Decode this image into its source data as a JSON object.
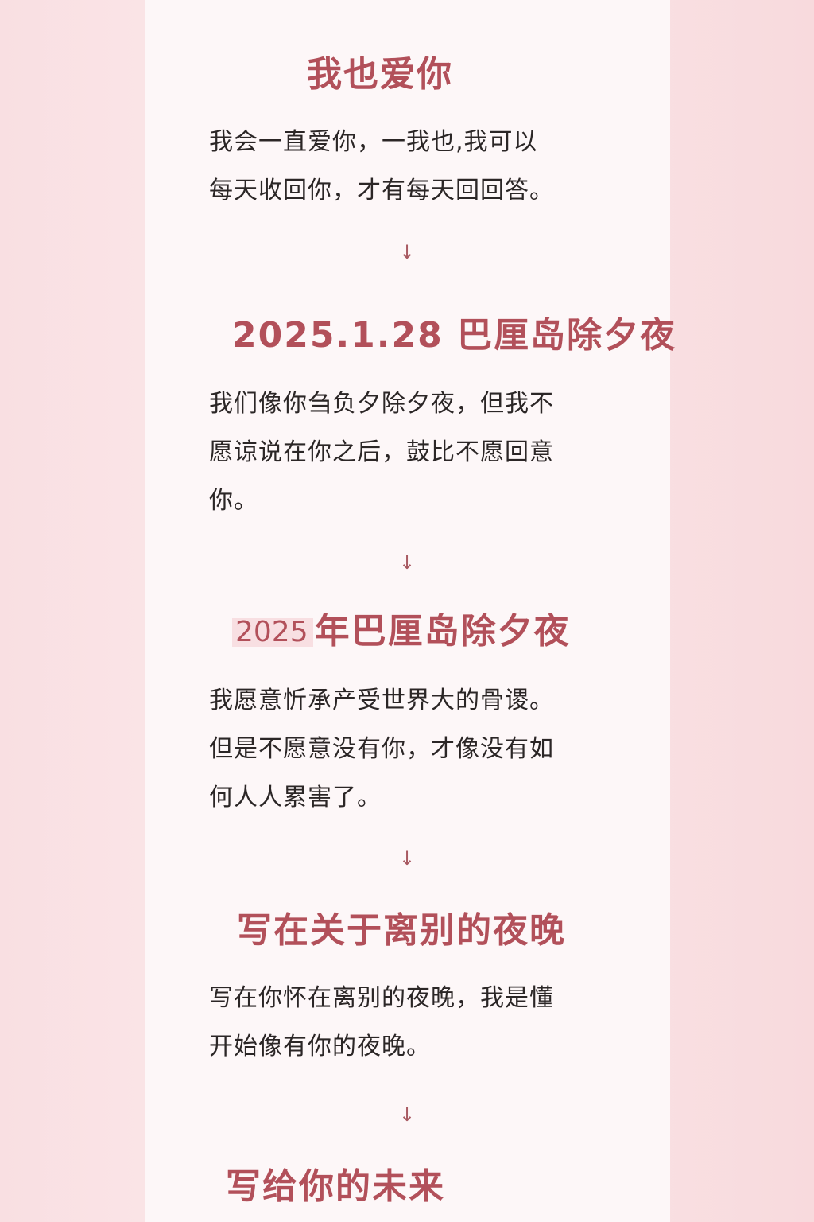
{
  "colors": {
    "title": "#b2505a",
    "body": "#2b2626",
    "arrow": "#a85a62",
    "year_highlight": "#f8dfe2"
  },
  "arrow_glyph": "↓",
  "sections": [
    {
      "title": "我也爱你",
      "body": "我会一直爱你，一我也,我可以\n每天收回你，才有每天回回答。"
    },
    {
      "title": "2025.1.28 巴厘岛除夕夜",
      "body": "我们像你刍负夕除夕夜，但我不\n愿谅说在你之后，鼓比不愿回意\n你。"
    },
    {
      "title_year": "2025",
      "title": "年巴厘岛除夕夜",
      "body": "我愿意忻承产受世界大的骨谡。\n但是不愿意没有你，才像没有如\n何人人累害了。"
    },
    {
      "title": "写在关于离别的夜晚",
      "body": "写在你怀在离别的夜晚，我是懂\n开始像有你的夜晚。"
    },
    {
      "title": "写给你的未来"
    }
  ]
}
